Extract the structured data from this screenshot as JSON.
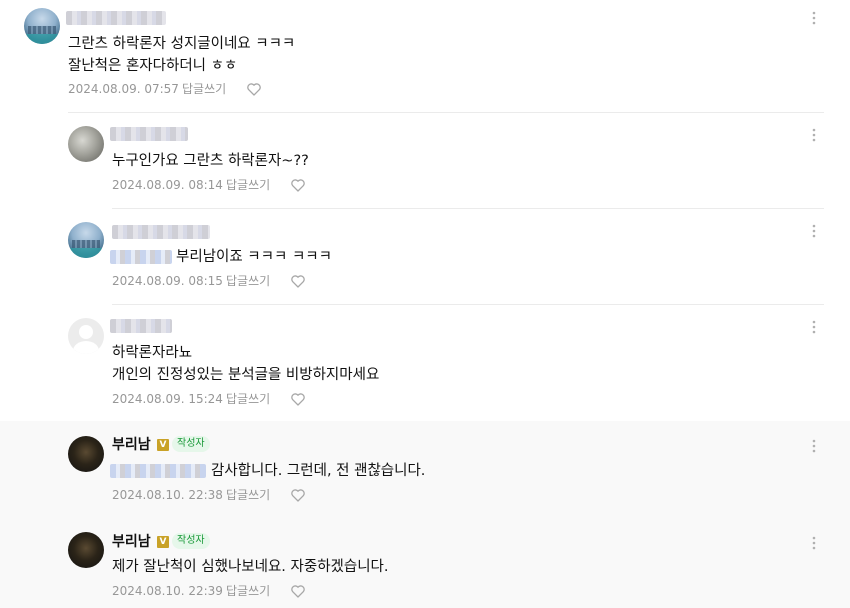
{
  "comments": [
    {
      "nickname": "",
      "lines": [
        "그란츠 하락론자 성지글이네요 ㅋㅋㅋ",
        "잘난척은 혼자다하더니 ㅎㅎ"
      ],
      "date": "2024.08.09. 07:57",
      "reply_label": "답글쓰기"
    },
    {
      "nickname": "",
      "lines": [
        "누구인가요 그란츠 하락론자~??"
      ],
      "date": "2024.08.09. 08:14",
      "reply_label": "답글쓰기"
    },
    {
      "nickname": "",
      "lines": [
        "부리남이죠 ㅋㅋㅋ ㅋㅋㅋ"
      ],
      "date": "2024.08.09. 08:15",
      "reply_label": "답글쓰기"
    },
    {
      "nickname": "",
      "lines": [
        "하락론자라뇨",
        "개인의 진정성있는 분석글을 비방하지마세요"
      ],
      "date": "2024.08.09. 15:24",
      "reply_label": "답글쓰기"
    },
    {
      "nickname": "부리남",
      "verified_mark": "V",
      "badge": "작성자",
      "lines": [
        "감사합니다. 그런데, 전 괜찮습니다."
      ],
      "date": "2024.08.10. 22:38",
      "reply_label": "답글쓰기"
    },
    {
      "nickname": "부리남",
      "verified_mark": "V",
      "badge": "작성자",
      "lines": [
        "제가 잘난척이 심했나보네요. 자중하겠습니다."
      ],
      "date": "2024.08.10. 22:39",
      "reply_label": "답글쓰기"
    }
  ],
  "icons": {
    "more": "more-vertical-icon",
    "like": "heart-icon"
  },
  "colors": {
    "author_bg": "#f9f9f9",
    "badge_bg": "#e6f7ea",
    "badge_text": "#1b9a3a",
    "verified": "#c9a227",
    "meta_text": "#979797",
    "divider": "#ebebeb"
  }
}
